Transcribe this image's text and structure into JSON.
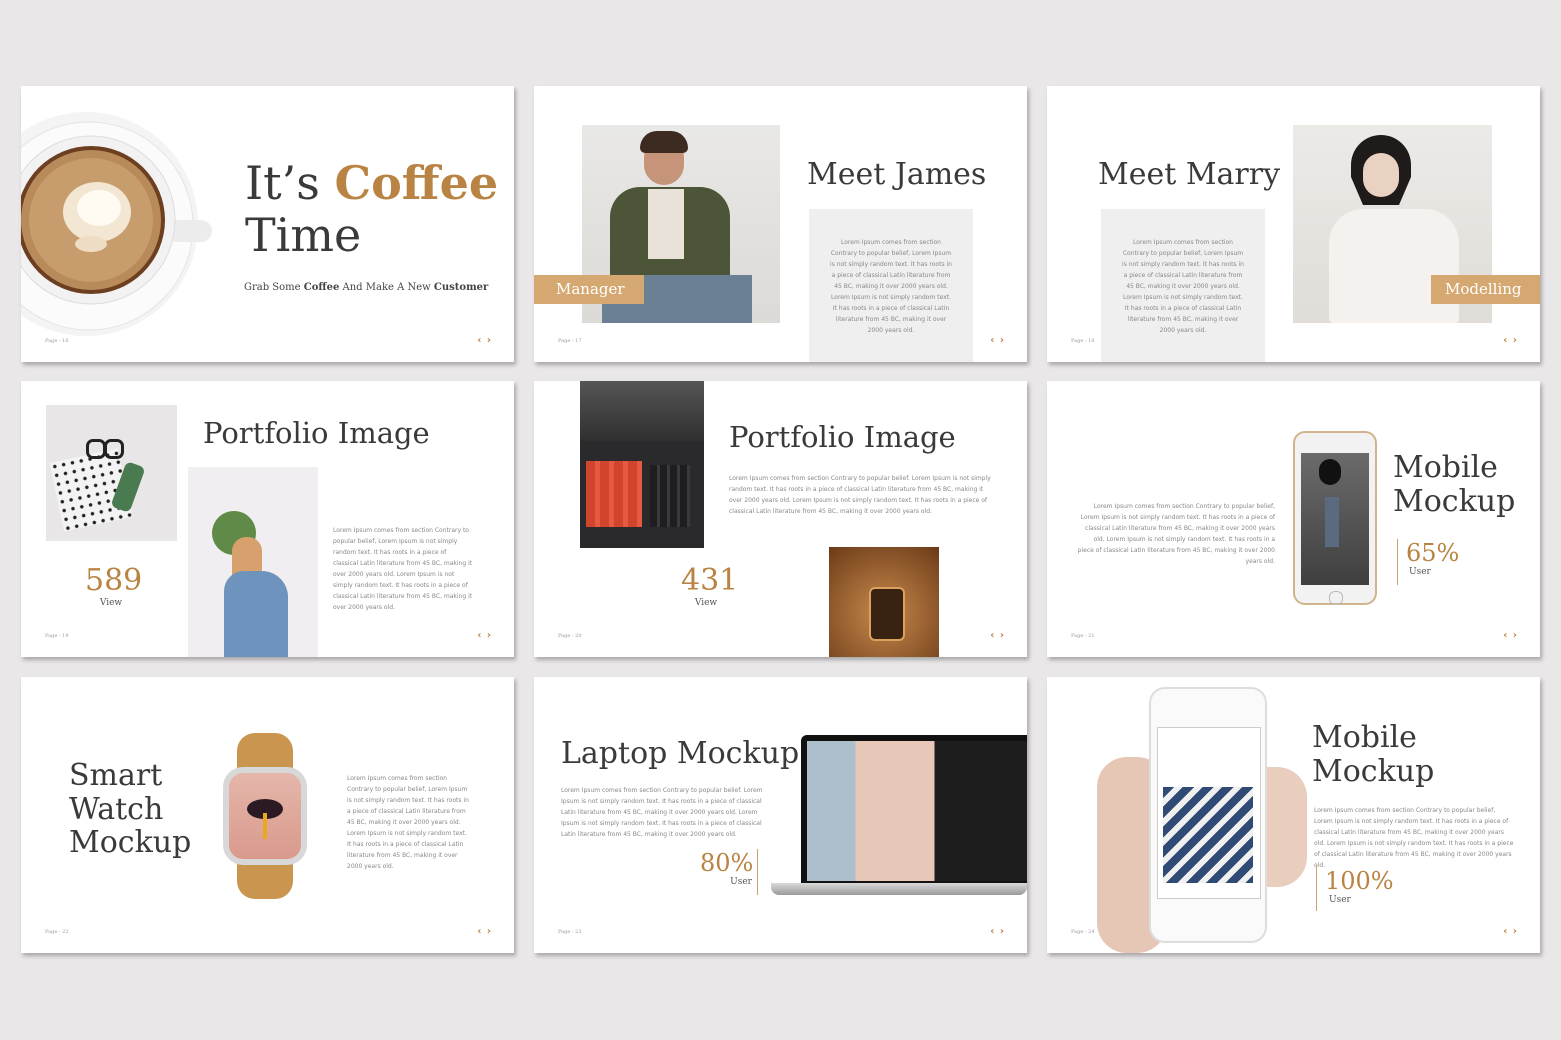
{
  "colors": {
    "accent": "#b98443",
    "tag": "#d6a871",
    "background": "#e9e7e8"
  },
  "nav_icon": "chevron-left-right-icon",
  "nav_glyph": "‹ ›",
  "slides": [
    {
      "title_a": "It’s ",
      "title_b": "Coffee",
      "title_c": "Time",
      "subtitle_a": "Grab Some ",
      "subtitle_b": "Coffee",
      "subtitle_c": " And Make A New ",
      "subtitle_d": "Customer",
      "page": "Page - 16"
    },
    {
      "title": "Meet James",
      "tag": "Manager",
      "text": "Lorem Ipsum comes from section Contrary to popular belief, Lorem Ipsum is not simply random text. It has roots in a piece of classical Latin literature from 45 BC, making it over 2000 years old. Lorem Ipsum is not simply random text. It has roots in a piece of classical Latin literature from 45 BC, making it over 2000 years old.",
      "page": "Page - 17"
    },
    {
      "title": "Meet Marry",
      "tag": "Modelling",
      "text": "Lorem Ipsum comes from section Contrary to popular belief, Lorem Ipsum is not simply random text. It has roots in a piece of classical Latin literature from 45 BC, making it over 2000 years old. Lorem Ipsum is not simply random text. It has roots in a piece of classical Latin literature from 45 BC, making it over 2000 years old.",
      "page": "Page - 18"
    },
    {
      "title": "Portfolio Image",
      "stat": "589",
      "stat_label": "View",
      "text": "Lorem Ipsum comes from section Contrary to popular belief, Lorem Ipsum is not simply random text. It has roots in a piece of classical Latin literature from 45 BC, making it over 2000 years old. Lorem Ipsum is not simply random text. It has roots in a piece of classical Latin literature from 45 BC, making it over 2000 years old.",
      "page": "Page - 19"
    },
    {
      "title": "Portfolio Image",
      "stat": "431",
      "stat_label": "View",
      "text": "Lorem Ipsum comes from section Contrary to popular belief. Lorem Ipsum is not simply random text. It has roots in a piece of classical Latin literature from 45 BC, making it over 2000 years old. Lorem Ipsum is not simply random text. It has roots in a piece of classical Latin literature from 45 BC, making it over 2000 years old.",
      "page": "Page - 20"
    },
    {
      "title_a": "Mobile",
      "title_b": "Mockup",
      "percent": "65%",
      "percent_label": "User",
      "text": "Lorem Ipsum comes from section Contrary to popular belief, Lorem Ipsum is not simply random text. It has roots in a piece of classical Latin literature from 45 BC, making it over 2000 years old. Lorem Ipsum is not simply random text. It has roots in a piece of classical Latin literature from 45 BC, making it over 2000 years old.",
      "page": "Page - 21"
    },
    {
      "title_a": "Smart",
      "title_b": "Watch",
      "title_c": "Mockup",
      "text": "Lorem Ipsum comes from section Contrary to popular belief, Lorem Ipsum is not simply random text. It has roots in a piece of classical Latin literature from 45 BC, making it over 2000 years old. Lorem Ipsum is not simply random text. It has roots in a piece of classical Latin literature from 45 BC, making it over 2000 years old.",
      "page": "Page - 22"
    },
    {
      "title": "Laptop Mockup",
      "percent": "80%",
      "percent_label": "User",
      "text": "Lorem Ipsum comes from section Contrary to popular belief. Lorem Ipsum is not simply random text. It has roots in a piece of classical Latin literature from 45 BC, making it over 2000 years old. Lorem Ipsum is not simply random text. It has roots in a piece of classical Latin literature from 45 BC, making it over 2000 years old.",
      "page": "Page - 23"
    },
    {
      "title_a": "Mobile",
      "title_b": "Mockup",
      "percent": "100%",
      "percent_label": "User",
      "text": "Lorem Ipsum comes from section Contrary to popular belief, Lorem Ipsum is not simply random text. It has roots in a piece of classical Latin literature from 45 BC, making it over 2000 years old. Lorem Ipsum is not simply random text. It has roots in a piece of classical Latin literature from 45 BC, making it over 2000 years old.",
      "page": "Page - 24"
    }
  ]
}
